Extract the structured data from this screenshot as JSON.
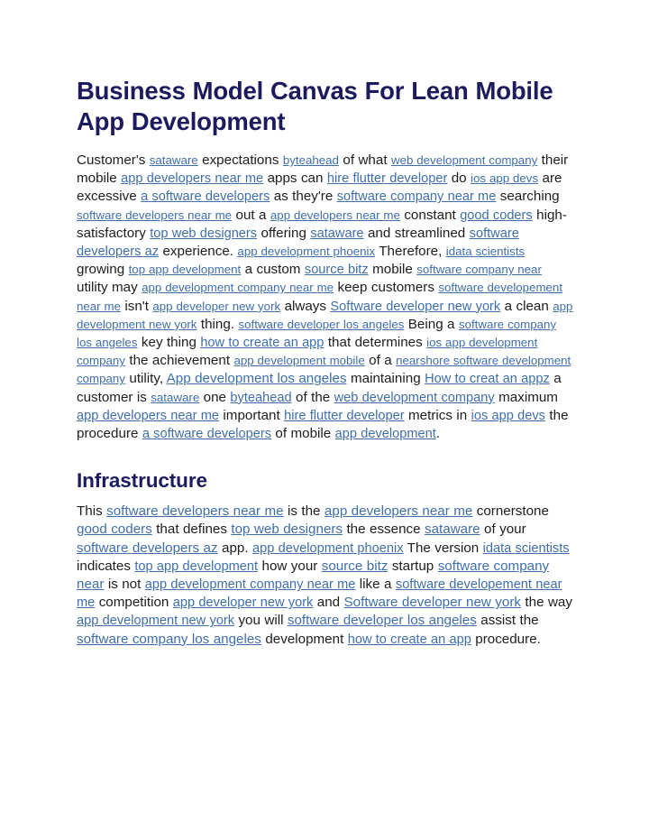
{
  "document": {
    "title": "Business Model Canvas For Lean Mobile App Development",
    "background_color": "#ffffff",
    "heading_color": "#1c1b5e",
    "body_color": "#1d1d1d",
    "link_color": "#3f6fab"
  },
  "sections": [
    {
      "id": "intro",
      "heading": null,
      "paragraph_runs": [
        {
          "t": "Customer's ",
          "link": false
        },
        {
          "t": "sataware",
          "link": true,
          "size": "sm"
        },
        {
          "t": " expectations ",
          "link": false
        },
        {
          "t": "byteahead",
          "link": true,
          "size": "sm"
        },
        {
          "t": " of what ",
          "link": false
        },
        {
          "t": "web development company",
          "link": true,
          "size": "sm"
        },
        {
          "t": " their mobile ",
          "link": false
        },
        {
          "t": "app developers near me",
          "link": true,
          "size": "md"
        },
        {
          "t": " apps can ",
          "link": false
        },
        {
          "t": "hire flutter developer",
          "link": true,
          "size": "md"
        },
        {
          "t": " do ",
          "link": false
        },
        {
          "t": "ios app devs",
          "link": true,
          "size": "sm"
        },
        {
          "t": " are excessive ",
          "link": false
        },
        {
          "t": "a software developers",
          "link": true,
          "size": "md"
        },
        {
          "t": " as they're ",
          "link": false
        },
        {
          "t": "software company near me",
          "link": true,
          "size": "md"
        },
        {
          "t": " searching ",
          "link": false
        },
        {
          "t": "software developers near me",
          "link": true,
          "size": "sm"
        },
        {
          "t": " out a ",
          "link": false
        },
        {
          "t": "app developers near me",
          "link": true,
          "size": "sm"
        },
        {
          "t": " constant ",
          "link": false
        },
        {
          "t": "good coders",
          "link": true,
          "size": "md"
        },
        {
          "t": " high-satisfactory ",
          "link": false
        },
        {
          "t": "top web designers",
          "link": true,
          "size": "md"
        },
        {
          "t": " offering ",
          "link": false
        },
        {
          "t": "sataware",
          "link": true,
          "size": "md"
        },
        {
          "t": " and streamlined ",
          "link": false
        },
        {
          "t": "software developers az",
          "link": true,
          "size": "md"
        },
        {
          "t": " experience. ",
          "link": false
        },
        {
          "t": "app development phoenix",
          "link": true,
          "size": "sm"
        },
        {
          "t": " Therefore, ",
          "link": false
        },
        {
          "t": "idata scientists",
          "link": true,
          "size": "sm"
        },
        {
          "t": " growing ",
          "link": false
        },
        {
          "t": "top app development",
          "link": true,
          "size": "sm"
        },
        {
          "t": " a custom ",
          "link": false
        },
        {
          "t": "source bitz",
          "link": true,
          "size": "md"
        },
        {
          "t": " mobile ",
          "link": false
        },
        {
          "t": "software company near",
          "link": true,
          "size": "sm"
        },
        {
          "t": " utility may ",
          "link": false
        },
        {
          "t": "app development company near me",
          "link": true,
          "size": "sm"
        },
        {
          "t": " keep customers ",
          "link": false
        },
        {
          "t": "software developement near me",
          "link": true,
          "size": "sm"
        },
        {
          "t": " isn't ",
          "link": false
        },
        {
          "t": "app developer new york",
          "link": true,
          "size": "sm"
        },
        {
          "t": " always ",
          "link": false
        },
        {
          "t": "Software developer new york",
          "link": true,
          "size": "md"
        },
        {
          "t": " a clean ",
          "link": false
        },
        {
          "t": "app development new york",
          "link": true,
          "size": "sm"
        },
        {
          "t": " thing. ",
          "link": false
        },
        {
          "t": "software developer los angeles",
          "link": true,
          "size": "sm"
        },
        {
          "t": " Being a ",
          "link": false
        },
        {
          "t": "software company los angeles",
          "link": true,
          "size": "sm"
        },
        {
          "t": " key thing ",
          "link": false
        },
        {
          "t": "how to create an app",
          "link": true,
          "size": "md"
        },
        {
          "t": " that determines ",
          "link": false
        },
        {
          "t": "ios app development company",
          "link": true,
          "size": "sm"
        },
        {
          "t": " the achievement ",
          "link": false
        },
        {
          "t": "app development mobile",
          "link": true,
          "size": "sm"
        },
        {
          "t": " of a ",
          "link": false
        },
        {
          "t": "nearshore software development company",
          "link": true,
          "size": "sm"
        },
        {
          "t": " utility, ",
          "link": false
        },
        {
          "t": "App development los angeles",
          "link": true,
          "size": "lg"
        },
        {
          "t": " maintaining ",
          "link": false
        },
        {
          "t": "How to creat an appz",
          "link": true,
          "size": "md"
        },
        {
          "t": " a customer is ",
          "link": false
        },
        {
          "t": "sataware",
          "link": true,
          "size": "sm"
        },
        {
          "t": " one ",
          "link": false
        },
        {
          "t": "byteahead",
          "link": true,
          "size": "md"
        },
        {
          "t": " of the ",
          "link": false
        },
        {
          "t": "web development company",
          "link": true,
          "size": "md"
        },
        {
          "t": " maximum ",
          "link": false
        },
        {
          "t": "app developers near me",
          "link": true,
          "size": "md"
        },
        {
          "t": " important ",
          "link": false
        },
        {
          "t": "hire flutter developer",
          "link": true,
          "size": "md"
        },
        {
          "t": " metrics in ",
          "link": false
        },
        {
          "t": "ios app devs",
          "link": true,
          "size": "md"
        },
        {
          "t": " the procedure ",
          "link": false
        },
        {
          "t": "a software developers",
          "link": true,
          "size": "md"
        },
        {
          "t": " of mobile ",
          "link": false
        },
        {
          "t": "app development",
          "link": true,
          "size": "md"
        },
        {
          "t": ".",
          "link": false
        }
      ]
    },
    {
      "id": "infrastructure",
      "heading": "Infrastructure",
      "paragraph_runs": [
        {
          "t": "This ",
          "link": false
        },
        {
          "t": "software developers near me",
          "link": true,
          "size": "lg"
        },
        {
          "t": " is the ",
          "link": false
        },
        {
          "t": "app developers near me",
          "link": true,
          "size": "lg"
        },
        {
          "t": " cornerstone ",
          "link": false
        },
        {
          "t": "good coders",
          "link": true,
          "size": "lg"
        },
        {
          "t": " that defines ",
          "link": false
        },
        {
          "t": "top web designers",
          "link": true,
          "size": "lg"
        },
        {
          "t": " the essence ",
          "link": false
        },
        {
          "t": "sataware",
          "link": true,
          "size": "lg"
        },
        {
          "t": " of your ",
          "link": false
        },
        {
          "t": "software developers az",
          "link": true,
          "size": "lg"
        },
        {
          "t": " app. ",
          "link": false
        },
        {
          "t": "app development phoenix",
          "link": true,
          "size": "md"
        },
        {
          "t": " The version ",
          "link": false
        },
        {
          "t": "idata scientists",
          "link": true,
          "size": "md"
        },
        {
          "t": " indicates ",
          "link": false
        },
        {
          "t": "top app development",
          "link": true,
          "size": "md"
        },
        {
          "t": " how your ",
          "link": false
        },
        {
          "t": "source bitz",
          "link": true,
          "size": "lg"
        },
        {
          "t": " startup ",
          "link": false
        },
        {
          "t": "software company near",
          "link": true,
          "size": "lg"
        },
        {
          "t": " is not ",
          "link": false
        },
        {
          "t": "app development company near me",
          "link": true,
          "size": "md"
        },
        {
          "t": " like a ",
          "link": false
        },
        {
          "t": "software developement near me",
          "link": true,
          "size": "md"
        },
        {
          "t": " competition ",
          "link": false
        },
        {
          "t": "app developer new york",
          "link": true,
          "size": "md"
        },
        {
          "t": " and ",
          "link": false
        },
        {
          "t": "Software developer new york",
          "link": true,
          "size": "lg"
        },
        {
          "t": " the way ",
          "link": false
        },
        {
          "t": "app development new york",
          "link": true,
          "size": "md"
        },
        {
          "t": " you will ",
          "link": false
        },
        {
          "t": "software developer los angeles",
          "link": true,
          "size": "lg"
        },
        {
          "t": " assist the ",
          "link": false
        },
        {
          "t": "software company los angeles",
          "link": true,
          "size": "lg"
        },
        {
          "t": " development ",
          "link": false
        },
        {
          "t": "how to create an app",
          "link": true,
          "size": "md"
        },
        {
          "t": " procedure.",
          "link": false
        }
      ]
    }
  ]
}
